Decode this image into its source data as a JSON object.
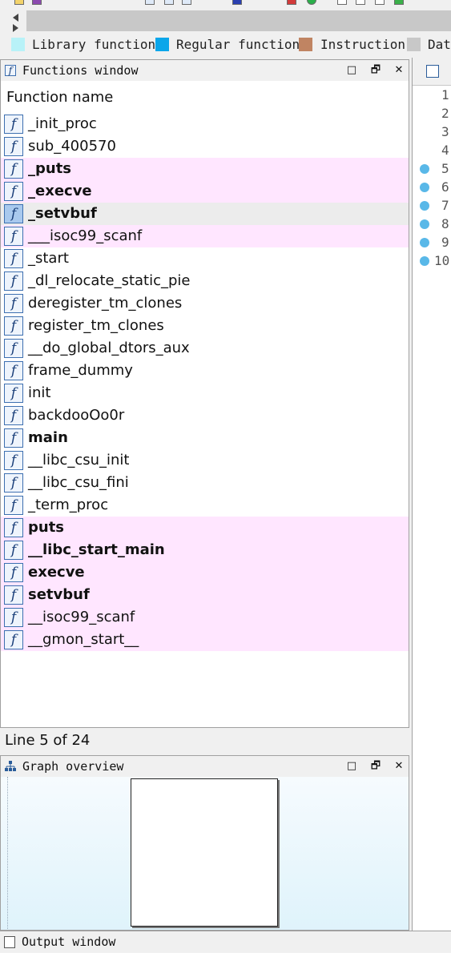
{
  "legend": [
    {
      "label": "Library function",
      "color": "#b8f2f8"
    },
    {
      "label": "Regular function",
      "color": "#0aa6ea"
    },
    {
      "label": "Instruction",
      "color": "#c08462"
    },
    {
      "label": "Data",
      "color": "#c8c8c8"
    }
  ],
  "functions_window": {
    "title": "Functions window",
    "column_header": "Function name",
    "buttons": {
      "minimize": "□",
      "restore": "🗗",
      "close": "✕"
    },
    "rows": [
      {
        "name": "_init_proc",
        "style": "regular"
      },
      {
        "name": "sub_400570",
        "style": "regular"
      },
      {
        "name": "_puts",
        "style": "import"
      },
      {
        "name": "_execve",
        "style": "import"
      },
      {
        "name": "_setvbuf",
        "style": "selected"
      },
      {
        "name": "___isoc99_scanf",
        "style": "import-light"
      },
      {
        "name": "_start",
        "style": "regular"
      },
      {
        "name": "_dl_relocate_static_pie",
        "style": "regular"
      },
      {
        "name": "deregister_tm_clones",
        "style": "regular"
      },
      {
        "name": "register_tm_clones",
        "style": "regular"
      },
      {
        "name": "__do_global_dtors_aux",
        "style": "regular"
      },
      {
        "name": "frame_dummy",
        "style": "regular"
      },
      {
        "name": "init",
        "style": "regular"
      },
      {
        "name": "backdooOo0r",
        "style": "regular"
      },
      {
        "name": "main",
        "style": "bold"
      },
      {
        "name": "__libc_csu_init",
        "style": "regular"
      },
      {
        "name": "__libc_csu_fini",
        "style": "regular"
      },
      {
        "name": "_term_proc",
        "style": "regular"
      },
      {
        "name": "puts",
        "style": "import"
      },
      {
        "name": "__libc_start_main",
        "style": "import"
      },
      {
        "name": "execve",
        "style": "import"
      },
      {
        "name": "setvbuf",
        "style": "import"
      },
      {
        "name": "__isoc99_scanf",
        "style": "import-light"
      },
      {
        "name": "__gmon_start__",
        "style": "import-light"
      }
    ],
    "status": "Line 5 of 24"
  },
  "graph_overview": {
    "title": "Graph overview"
  },
  "right_panel": {
    "line_numbers": [
      "1",
      "2",
      "3",
      "4",
      "5",
      "6",
      "7",
      "8",
      "9",
      "10"
    ],
    "dotted_lines": [
      5,
      6,
      7,
      8,
      9,
      10
    ]
  },
  "output_window": {
    "title": "Output window"
  }
}
